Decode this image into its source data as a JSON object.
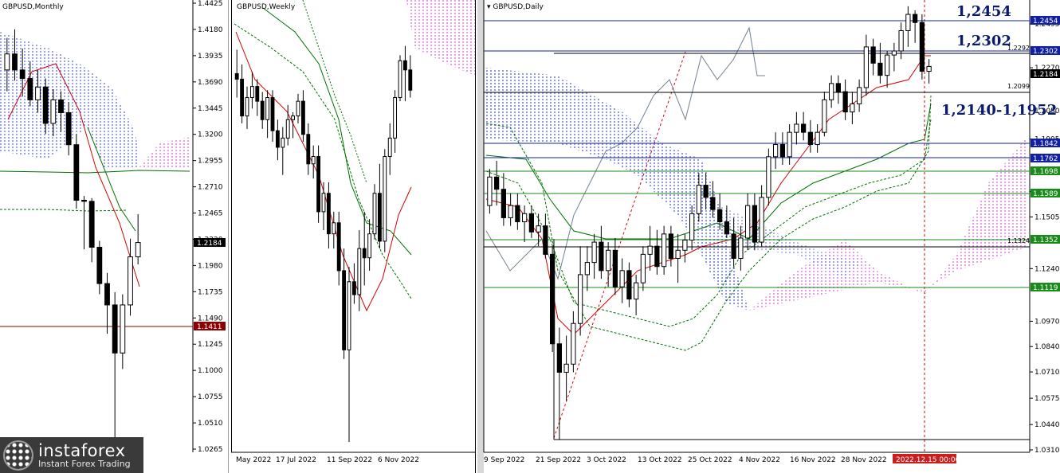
{
  "monthly": {
    "title": "GBPUSD,Monthly",
    "y_ticks": [
      "1.4425",
      "1.4180",
      "1.3935",
      "1.3690",
      "1.3445",
      "1.3200",
      "1.2955",
      "1.2710",
      "1.2465",
      "1.2220",
      "1.1980",
      "1.1735",
      "1.1490",
      "1.1245",
      "1.1000",
      "1.0755",
      "1.0510",
      "1.0265"
    ],
    "y_min": 1.0265,
    "y_max": 1.4425,
    "price_label": "1.2184",
    "level_label": "1.1411"
  },
  "weekly": {
    "title": "GBPUSD,Weekly",
    "x_labels": [
      "May 2022",
      "17 Jul 2022",
      "11 Sep 2022",
      "6 Nov 2022"
    ]
  },
  "daily": {
    "title": "GBPUSD,Daily",
    "y_min": 1.031,
    "y_max": 1.2495,
    "y_ticks": [
      "1.2495",
      "1.2270",
      "1.2050",
      "1.1905",
      "1.1635",
      "1.1505",
      "1.1240",
      "1.0970",
      "1.0840",
      "1.0710",
      "1.0575",
      "1.0440",
      "1.0310"
    ],
    "x_labels": [
      "9 Sep 2022",
      "21 Sep 2022",
      "3 Oct 2022",
      "13 Oct 2022",
      "25 Oct 2022",
      "4 Nov 2022",
      "16 Nov 2022",
      "28 Nov 2022"
    ],
    "cursor_label": "2022.12.15 00:00",
    "price_label": "1.2184",
    "blue_levels": [
      "1.2454",
      "1.2302",
      "1.1842",
      "1.1762"
    ],
    "green_levels": [
      "1.1698",
      "1.1589",
      "1.1352",
      "1.1119"
    ],
    "small_labels": [
      "1.2292",
      "1.2099",
      "1.1324"
    ],
    "annotations": [
      "1,2454",
      "1,2302",
      "1,2140-1,1952"
    ]
  },
  "logo": {
    "brand": "instaforex",
    "tagline": "Instant Forex Trading"
  },
  "colors": {
    "bull": "#ffffff",
    "bear": "#000000",
    "tenkan": "#d40000",
    "kijun": "#007000",
    "level_blue": "#1020a0",
    "level_green": "#1a8a1a",
    "cloud_blue": "#2030d0",
    "cloud_magenta": "#d040d0"
  },
  "chart_data": [
    {
      "type": "candlestick",
      "title": "GBPUSD,Monthly",
      "ylim": [
        1.0265,
        1.4425
      ],
      "close_last": 1.2184,
      "levels": [
        1.1411
      ],
      "candles": [
        {
          "o": 1.38,
          "h": 1.41,
          "l": 1.36,
          "c": 1.395
        },
        {
          "o": 1.395,
          "h": 1.418,
          "l": 1.37,
          "c": 1.38
        },
        {
          "o": 1.38,
          "h": 1.4,
          "l": 1.355,
          "c": 1.372
        },
        {
          "o": 1.372,
          "h": 1.388,
          "l": 1.346,
          "c": 1.352
        },
        {
          "o": 1.352,
          "h": 1.38,
          "l": 1.34,
          "c": 1.364
        },
        {
          "o": 1.364,
          "h": 1.372,
          "l": 1.32,
          "c": 1.33
        },
        {
          "o": 1.33,
          "h": 1.362,
          "l": 1.318,
          "c": 1.352
        },
        {
          "o": 1.352,
          "h": 1.36,
          "l": 1.322,
          "c": 1.34
        },
        {
          "o": 1.34,
          "h": 1.35,
          "l": 1.3,
          "c": 1.31
        },
        {
          "o": 1.31,
          "h": 1.32,
          "l": 1.25,
          "c": 1.258
        },
        {
          "o": 1.258,
          "h": 1.262,
          "l": 1.212,
          "c": 1.257
        },
        {
          "o": 1.257,
          "h": 1.26,
          "l": 1.2,
          "c": 1.214
        },
        {
          "o": 1.214,
          "h": 1.22,
          "l": 1.17,
          "c": 1.18
        },
        {
          "o": 1.18,
          "h": 1.19,
          "l": 1.133,
          "c": 1.16
        },
        {
          "o": 1.16,
          "h": 1.172,
          "l": 1.035,
          "c": 1.115
        },
        {
          "o": 1.115,
          "h": 1.17,
          "l": 1.1,
          "c": 1.16
        },
        {
          "o": 1.16,
          "h": 1.222,
          "l": 1.15,
          "c": 1.205
        },
        {
          "o": 1.205,
          "h": 1.245,
          "l": 1.198,
          "c": 1.2184
        }
      ]
    },
    {
      "type": "candlestick",
      "title": "GBPUSD,Weekly",
      "x_labels": [
        "May 2022",
        "17 Jul 2022",
        "11 Sep 2022",
        "6 Nov 2022"
      ],
      "ylim": [
        1.035,
        1.262
      ],
      "candles": [
        {
          "o": 1.235,
          "h": 1.248,
          "l": 1.222,
          "c": 1.232
        },
        {
          "o": 1.232,
          "h": 1.24,
          "l": 1.208,
          "c": 1.212
        },
        {
          "o": 1.212,
          "h": 1.228,
          "l": 1.205,
          "c": 1.222
        },
        {
          "o": 1.222,
          "h": 1.236,
          "l": 1.216,
          "c": 1.228
        },
        {
          "o": 1.228,
          "h": 1.232,
          "l": 1.212,
          "c": 1.22
        },
        {
          "o": 1.22,
          "h": 1.225,
          "l": 1.205,
          "c": 1.21
        },
        {
          "o": 1.21,
          "h": 1.226,
          "l": 1.2,
          "c": 1.222
        },
        {
          "o": 1.222,
          "h": 1.226,
          "l": 1.198,
          "c": 1.204
        },
        {
          "o": 1.204,
          "h": 1.21,
          "l": 1.188,
          "c": 1.195
        },
        {
          "o": 1.195,
          "h": 1.206,
          "l": 1.18,
          "c": 1.2
        },
        {
          "o": 1.2,
          "h": 1.218,
          "l": 1.196,
          "c": 1.21
        },
        {
          "o": 1.21,
          "h": 1.214,
          "l": 1.2,
          "c": 1.212
        },
        {
          "o": 1.212,
          "h": 1.224,
          "l": 1.208,
          "c": 1.22
        },
        {
          "o": 1.22,
          "h": 1.226,
          "l": 1.198,
          "c": 1.202
        },
        {
          "o": 1.202,
          "h": 1.208,
          "l": 1.18,
          "c": 1.186
        },
        {
          "o": 1.186,
          "h": 1.196,
          "l": 1.178,
          "c": 1.19
        },
        {
          "o": 1.19,
          "h": 1.196,
          "l": 1.154,
          "c": 1.16
        },
        {
          "o": 1.16,
          "h": 1.176,
          "l": 1.15,
          "c": 1.17
        },
        {
          "o": 1.17,
          "h": 1.176,
          "l": 1.14,
          "c": 1.148
        },
        {
          "o": 1.148,
          "h": 1.16,
          "l": 1.14,
          "c": 1.154
        },
        {
          "o": 1.154,
          "h": 1.16,
          "l": 1.12,
          "c": 1.128
        },
        {
          "o": 1.128,
          "h": 1.14,
          "l": 1.08,
          "c": 1.085
        },
        {
          "o": 1.085,
          "h": 1.13,
          "l": 1.035,
          "c": 1.122
        },
        {
          "o": 1.122,
          "h": 1.132,
          "l": 1.11,
          "c": 1.115
        },
        {
          "o": 1.115,
          "h": 1.15,
          "l": 1.106,
          "c": 1.14
        },
        {
          "o": 1.14,
          "h": 1.16,
          "l": 1.12,
          "c": 1.135
        },
        {
          "o": 1.135,
          "h": 1.156,
          "l": 1.128,
          "c": 1.148
        },
        {
          "o": 1.148,
          "h": 1.175,
          "l": 1.145,
          "c": 1.17
        },
        {
          "o": 1.17,
          "h": 1.186,
          "l": 1.14,
          "c": 1.144
        },
        {
          "o": 1.144,
          "h": 1.194,
          "l": 1.138,
          "c": 1.19
        },
        {
          "o": 1.19,
          "h": 1.208,
          "l": 1.18,
          "c": 1.2
        },
        {
          "o": 1.2,
          "h": 1.226,
          "l": 1.192,
          "c": 1.222
        },
        {
          "o": 1.222,
          "h": 1.245,
          "l": 1.22,
          "c": 1.242
        },
        {
          "o": 1.242,
          "h": 1.25,
          "l": 1.22,
          "c": 1.237
        },
        {
          "o": 1.237,
          "h": 1.245,
          "l": 1.222,
          "c": 1.226
        }
      ]
    },
    {
      "type": "candlestick",
      "title": "GBPUSD,Daily",
      "x_labels": [
        "9 Sep 2022",
        "21 Sep 2022",
        "3 Oct 2022",
        "13 Oct 2022",
        "25 Oct 2022",
        "4 Nov 2022",
        "16 Nov 2022",
        "28 Nov 2022",
        "2022.12.15 00:00"
      ],
      "ylim": [
        1.031,
        1.2495
      ],
      "close_last": 1.2184,
      "levels": {
        "resistance": [
          1.2454,
          1.2302
        ],
        "blue": [
          1.1842,
          1.1762
        ],
        "green": [
          1.1698,
          1.1589,
          1.1352,
          1.1119
        ],
        "other": [
          1.2292,
          1.2099,
          1.1324
        ]
      },
      "annotations": [
        "1,2454",
        "1,2302",
        "1,2140-1,1952"
      ],
      "candles": [
        {
          "o": 1.15,
          "h": 1.168,
          "l": 1.146,
          "c": 1.164
        },
        {
          "o": 1.164,
          "h": 1.172,
          "l": 1.15,
          "c": 1.158
        },
        {
          "o": 1.158,
          "h": 1.166,
          "l": 1.14,
          "c": 1.144
        },
        {
          "o": 1.144,
          "h": 1.156,
          "l": 1.14,
          "c": 1.15
        },
        {
          "o": 1.15,
          "h": 1.156,
          "l": 1.138,
          "c": 1.142
        },
        {
          "o": 1.142,
          "h": 1.15,
          "l": 1.132,
          "c": 1.146
        },
        {
          "o": 1.146,
          "h": 1.15,
          "l": 1.134,
          "c": 1.137
        },
        {
          "o": 1.137,
          "h": 1.146,
          "l": 1.13,
          "c": 1.14
        },
        {
          "o": 1.14,
          "h": 1.146,
          "l": 1.124,
          "c": 1.126
        },
        {
          "o": 1.126,
          "h": 1.13,
          "l": 1.078,
          "c": 1.082
        },
        {
          "o": 1.082,
          "h": 1.09,
          "l": 1.035,
          "c": 1.068
        },
        {
          "o": 1.068,
          "h": 1.086,
          "l": 1.054,
          "c": 1.072
        },
        {
          "o": 1.072,
          "h": 1.098,
          "l": 1.068,
          "c": 1.092
        },
        {
          "o": 1.092,
          "h": 1.13,
          "l": 1.086,
          "c": 1.116
        },
        {
          "o": 1.116,
          "h": 1.13,
          "l": 1.108,
          "c": 1.122
        },
        {
          "o": 1.122,
          "h": 1.136,
          "l": 1.114,
          "c": 1.132
        },
        {
          "o": 1.132,
          "h": 1.14,
          "l": 1.114,
          "c": 1.118
        },
        {
          "o": 1.118,
          "h": 1.132,
          "l": 1.11,
          "c": 1.128
        },
        {
          "o": 1.128,
          "h": 1.134,
          "l": 1.106,
          "c": 1.11
        },
        {
          "o": 1.11,
          "h": 1.124,
          "l": 1.102,
          "c": 1.118
        },
        {
          "o": 1.118,
          "h": 1.122,
          "l": 1.1,
          "c": 1.104
        },
        {
          "o": 1.104,
          "h": 1.116,
          "l": 1.096,
          "c": 1.112
        },
        {
          "o": 1.112,
          "h": 1.13,
          "l": 1.108,
          "c": 1.126
        },
        {
          "o": 1.126,
          "h": 1.14,
          "l": 1.118,
          "c": 1.13
        },
        {
          "o": 1.13,
          "h": 1.138,
          "l": 1.116,
          "c": 1.12
        },
        {
          "o": 1.12,
          "h": 1.14,
          "l": 1.116,
          "c": 1.136
        },
        {
          "o": 1.136,
          "h": 1.14,
          "l": 1.12,
          "c": 1.124
        },
        {
          "o": 1.124,
          "h": 1.136,
          "l": 1.112,
          "c": 1.128
        },
        {
          "o": 1.128,
          "h": 1.136,
          "l": 1.122,
          "c": 1.133
        },
        {
          "o": 1.133,
          "h": 1.15,
          "l": 1.128,
          "c": 1.146
        },
        {
          "o": 1.146,
          "h": 1.166,
          "l": 1.142,
          "c": 1.16
        },
        {
          "o": 1.16,
          "h": 1.166,
          "l": 1.148,
          "c": 1.154
        },
        {
          "o": 1.154,
          "h": 1.162,
          "l": 1.144,
          "c": 1.148
        },
        {
          "o": 1.148,
          "h": 1.156,
          "l": 1.138,
          "c": 1.142
        },
        {
          "o": 1.142,
          "h": 1.15,
          "l": 1.134,
          "c": 1.136
        },
        {
          "o": 1.136,
          "h": 1.144,
          "l": 1.12,
          "c": 1.124
        },
        {
          "o": 1.124,
          "h": 1.14,
          "l": 1.118,
          "c": 1.134
        },
        {
          "o": 1.134,
          "h": 1.156,
          "l": 1.128,
          "c": 1.15
        },
        {
          "o": 1.15,
          "h": 1.156,
          "l": 1.128,
          "c": 1.132
        },
        {
          "o": 1.132,
          "h": 1.16,
          "l": 1.13,
          "c": 1.154
        },
        {
          "o": 1.154,
          "h": 1.178,
          "l": 1.15,
          "c": 1.174
        },
        {
          "o": 1.174,
          "h": 1.186,
          "l": 1.168,
          "c": 1.18
        },
        {
          "o": 1.18,
          "h": 1.186,
          "l": 1.17,
          "c": 1.174
        },
        {
          "o": 1.174,
          "h": 1.19,
          "l": 1.17,
          "c": 1.186
        },
        {
          "o": 1.186,
          "h": 1.196,
          "l": 1.18,
          "c": 1.19
        },
        {
          "o": 1.19,
          "h": 1.196,
          "l": 1.182,
          "c": 1.186
        },
        {
          "o": 1.186,
          "h": 1.192,
          "l": 1.176,
          "c": 1.18
        },
        {
          "o": 1.18,
          "h": 1.19,
          "l": 1.176,
          "c": 1.186
        },
        {
          "o": 1.186,
          "h": 1.206,
          "l": 1.184,
          "c": 1.202
        },
        {
          "o": 1.202,
          "h": 1.214,
          "l": 1.198,
          "c": 1.21
        },
        {
          "o": 1.21,
          "h": 1.214,
          "l": 1.2,
          "c": 1.206
        },
        {
          "o": 1.206,
          "h": 1.212,
          "l": 1.192,
          "c": 1.196
        },
        {
          "o": 1.196,
          "h": 1.206,
          "l": 1.19,
          "c": 1.2
        },
        {
          "o": 1.2,
          "h": 1.212,
          "l": 1.196,
          "c": 1.208
        },
        {
          "o": 1.208,
          "h": 1.234,
          "l": 1.204,
          "c": 1.228
        },
        {
          "o": 1.228,
          "h": 1.232,
          "l": 1.214,
          "c": 1.22
        },
        {
          "o": 1.22,
          "h": 1.23,
          "l": 1.21,
          "c": 1.214
        },
        {
          "o": 1.214,
          "h": 1.226,
          "l": 1.208,
          "c": 1.224
        },
        {
          "o": 1.224,
          "h": 1.23,
          "l": 1.216,
          "c": 1.226
        },
        {
          "o": 1.226,
          "h": 1.24,
          "l": 1.222,
          "c": 1.236
        },
        {
          "o": 1.236,
          "h": 1.248,
          "l": 1.228,
          "c": 1.244
        },
        {
          "o": 1.244,
          "h": 1.246,
          "l": 1.23,
          "c": 1.24
        },
        {
          "o": 1.24,
          "h": 1.244,
          "l": 1.212,
          "c": 1.216
        },
        {
          "o": 1.216,
          "h": 1.222,
          "l": 1.21,
          "c": 1.2184
        }
      ]
    }
  ]
}
